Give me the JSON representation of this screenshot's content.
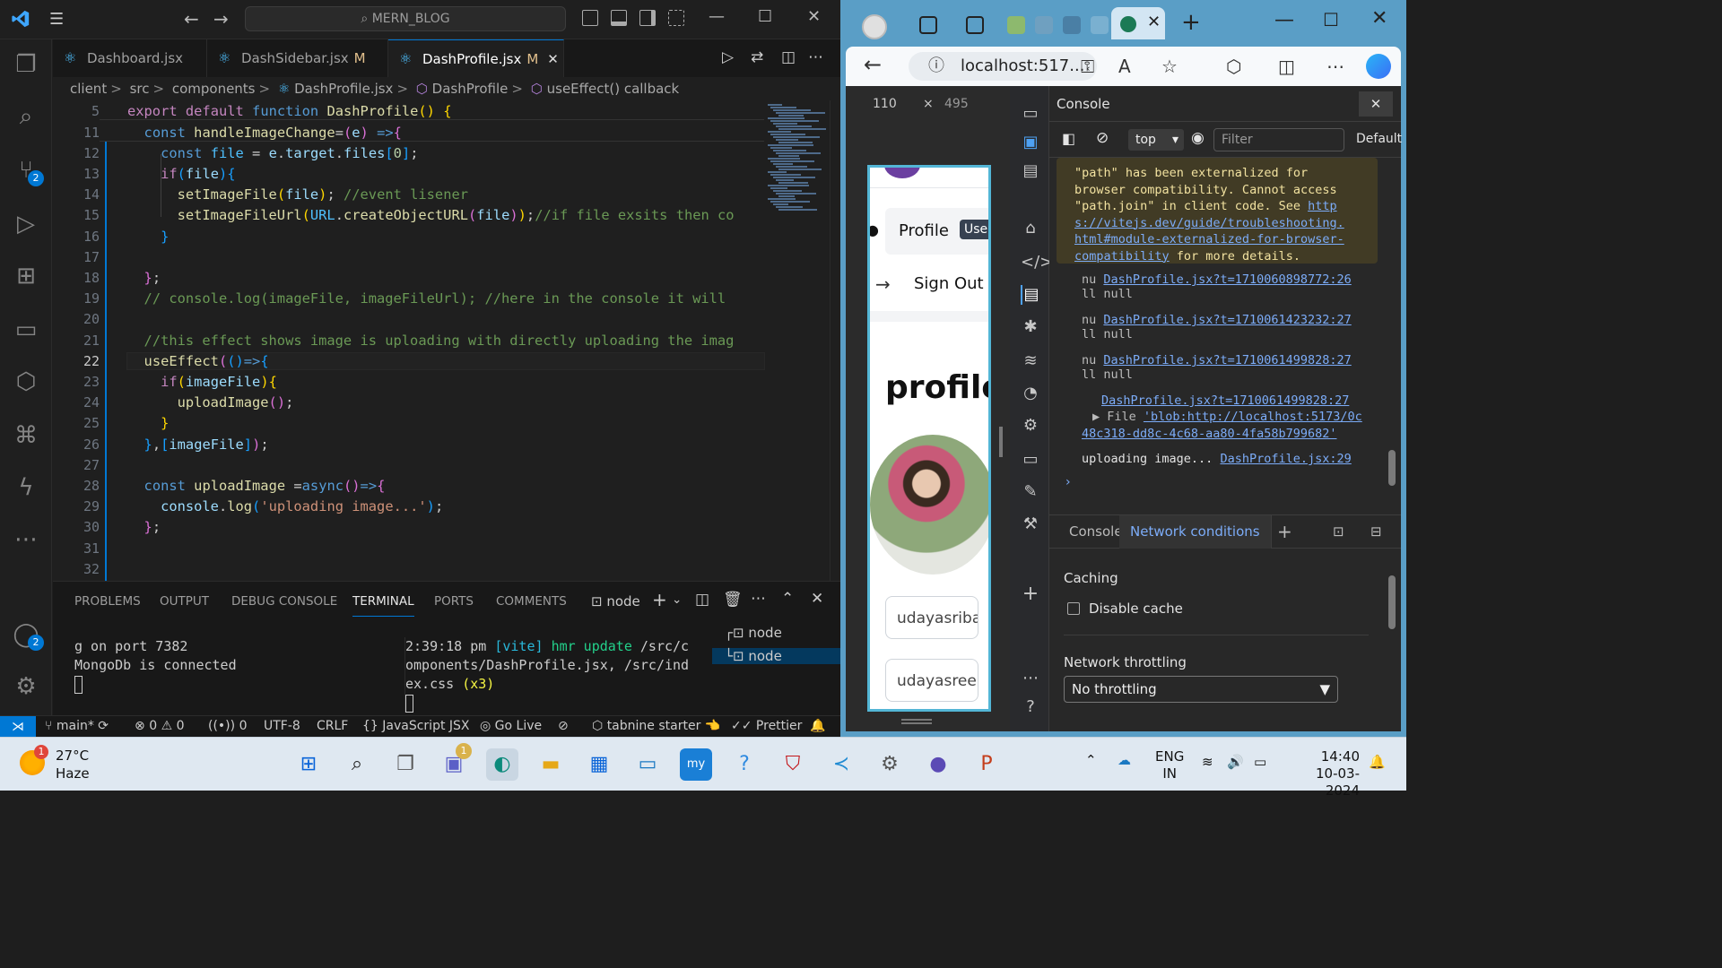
{
  "vscode": {
    "search": "MERN_BLOG",
    "activity_badges": {
      "source_control": "2",
      "accounts": "2"
    },
    "tabs": [
      {
        "label": "Dashboard.jsx",
        "modified": ""
      },
      {
        "label": "DashSidebar.jsx",
        "modified": "M"
      },
      {
        "label": "DashProfile.jsx",
        "modified": "M",
        "close": "✕"
      }
    ],
    "breadcrumb": [
      "client",
      "src",
      "components",
      "DashProfile.jsx",
      "DashProfile",
      "useEffect() callback"
    ],
    "line_numbers": [
      "5",
      "11",
      "12",
      "13",
      "14",
      "15",
      "16",
      "17",
      "18",
      "19",
      "20",
      "21",
      "22",
      "23",
      "24",
      "25",
      "26",
      "27",
      "28",
      "29",
      "30",
      "31",
      "32"
    ],
    "panel_tabs": [
      "PROBLEMS",
      "OUTPUT",
      "DEBUG CONSOLE",
      "TERMINAL",
      "PORTS",
      "COMMENTS"
    ],
    "terminal_name": "node",
    "terminal_left": [
      "g on port 7382",
      "MongoDb is connected"
    ],
    "terminal_right": {
      "time": "2:39:18 pm",
      "tag": "[vite]",
      "hmr": "hmr update",
      "path1": "/src/c",
      "path2": "omponents/DashProfile.jsx, /src/ind",
      "path3": "ex.css",
      "count": "(x3)"
    },
    "terminal_list": [
      "node",
      "node"
    ],
    "status": {
      "branch": "main*",
      "errors": "0",
      "warnings": "0",
      "ports": "0",
      "encoding": "UTF-8",
      "eol": "CRLF",
      "language": "JavaScript JSX",
      "golive": "Go Live",
      "tabnine": "tabnine starter",
      "prettier": "Prettier"
    }
  },
  "browser": {
    "url": "localhost:517...",
    "viewport": {
      "width": "110",
      "sep": "×",
      "height": "495"
    },
    "page": {
      "profile_item": "Profile",
      "user_badge": "Use",
      "signout_item": "Sign Out",
      "heading": "profile",
      "username_field": "udayasriba",
      "email_field": "udayasreel"
    },
    "devtools": {
      "title": "Console",
      "context": "top",
      "filter_placeholder": "Filter",
      "levels": "Default",
      "warning_lines": [
        "\"path\" has been externalized for",
        "browser compatibility. Cannot access",
        "\"path.join\" in client code. See "
      ],
      "warning_link_start": "http",
      "warning_link": [
        "s://vitejs.dev/guide/troubleshooting.",
        "html#module-externalized-for-browser-",
        "compatibility"
      ],
      "warning_tail": " for more details.",
      "logs": [
        {
          "prefix": "nu",
          "link": "DashProfile.jsx?t=1710060898772:26",
          "second": "ll null"
        },
        {
          "prefix": "nu",
          "link": "DashProfile.jsx?t=1710061423232:27",
          "second": "ll null"
        },
        {
          "prefix": "nu",
          "link": "DashProfile.jsx?t=1710061499828:27",
          "second": "ll null"
        }
      ],
      "file_log_link": "DashProfile.jsx?t=1710061499828:27",
      "file_prefix": "File",
      "file_blob": "'blob:http://localhost:5173/0c",
      "file_blob2": "48c318-dd8c-4c68-aa80-4fa58b799682'",
      "upload_text": "uploading image...",
      "upload_link": "DashProfile.jsx:29",
      "drawer_tabs": [
        "Console",
        "Network conditions"
      ],
      "caching_label": "Caching",
      "disable_cache": "Disable cache",
      "throttling_label": "Network throttling",
      "throttling_value": "No throttling"
    }
  },
  "taskbar": {
    "temp": "27°C",
    "weather": "Haze",
    "weather_badge": "1",
    "chat_badge": "1",
    "lang1": "ENG",
    "lang2": "IN",
    "time": "14:40",
    "date": "10-03-2024"
  }
}
